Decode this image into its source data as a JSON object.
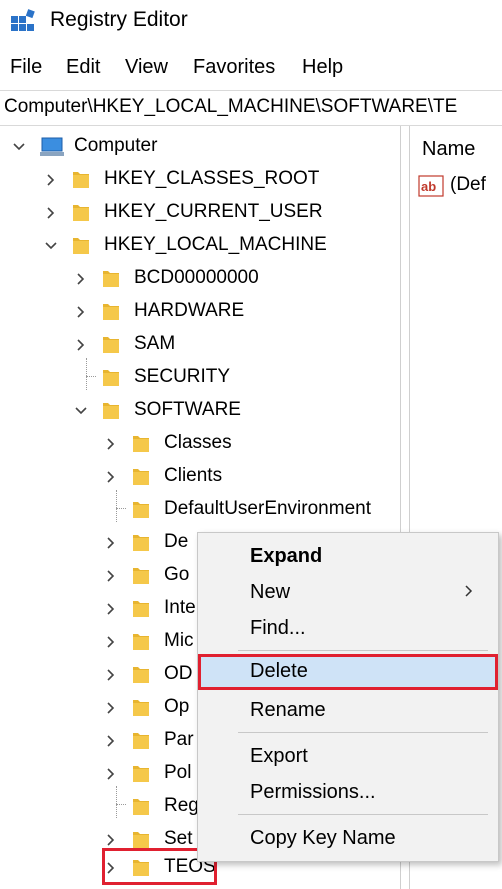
{
  "window": {
    "title": "Registry Editor",
    "app_icon": "registry-editor-icon"
  },
  "menu": [
    "File",
    "Edit",
    "View",
    "Favorites",
    "Help"
  ],
  "address_bar": {
    "path": "Computer\\HKEY_LOCAL_MACHINE\\SOFTWARE\\TE"
  },
  "tree": {
    "root": "Computer",
    "hives": [
      "HKEY_CLASSES_ROOT",
      "HKEY_CURRENT_USER",
      "HKEY_LOCAL_MACHINE"
    ],
    "hklm_children": [
      "BCD00000000",
      "HARDWARE",
      "SAM",
      "SECURITY",
      "SOFTWARE"
    ],
    "software_children": [
      "Classes",
      "Clients",
      "DefaultUserEnvironment",
      "De",
      "Go",
      "Inte",
      "Mic",
      "OD",
      "Op",
      "Par",
      "Pol",
      "Reg",
      "Set",
      "TEOS"
    ]
  },
  "right_pane": {
    "column_name": "Name",
    "first_value": "(Def"
  },
  "context_menu": {
    "items": [
      "Expand",
      "New",
      "Find...",
      "Delete",
      "Rename",
      "Export",
      "Permissions...",
      "Copy Key Name"
    ],
    "highlighted": "Delete"
  },
  "colors": {
    "folder": "#e8b530",
    "highlight": "#cfe3f7",
    "annotation_red": "#e02030"
  }
}
